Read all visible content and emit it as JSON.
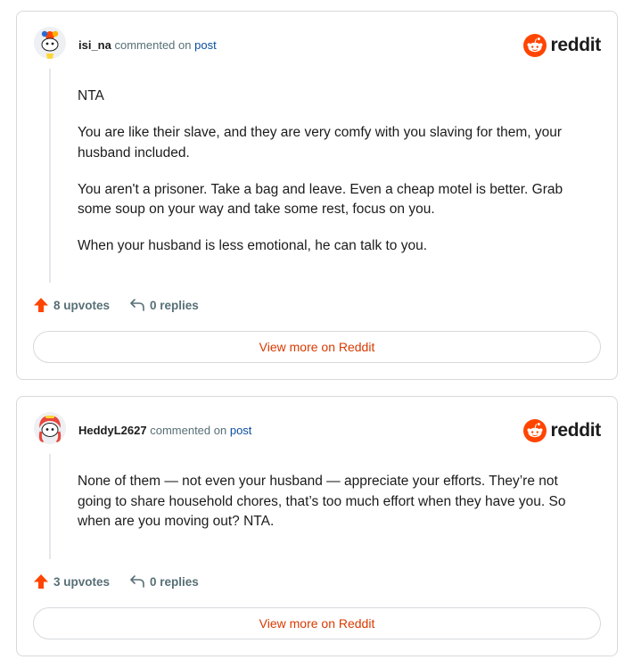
{
  "brand": {
    "wordmark": "reddit",
    "accent_color": "#ff4500",
    "link_color": "#0a4fa0",
    "muted_color": "#576f76"
  },
  "comments": [
    {
      "username": "isi_na",
      "commented_on": "commented on",
      "post_label": "post",
      "paragraphs": [
        "NTA",
        "You are like their slave, and they are very comfy with you slaving for them, your husband included.",
        "You aren't a prisoner. Take a bag and leave. Even a cheap motel is better. Grab some soup on your way and take some rest, focus on you.",
        "When your husband is less emotional, he can talk to you."
      ],
      "upvotes": "8 upvotes",
      "replies": "0 replies",
      "view_more": "View more on Reddit",
      "avatar_icon": "snoo-avatar-icon"
    },
    {
      "username": "HeddyL2627",
      "commented_on": "commented on",
      "post_label": "post",
      "paragraphs": [
        "None of them — not even your husband — appreciate your efforts. They’re not going to share household chores, that’s too much effort when they have you. So when are you moving out? NTA."
      ],
      "upvotes": "3 upvotes",
      "replies": "0 replies",
      "view_more": "View more on Reddit",
      "avatar_icon": "snoo-avatar-icon"
    }
  ]
}
